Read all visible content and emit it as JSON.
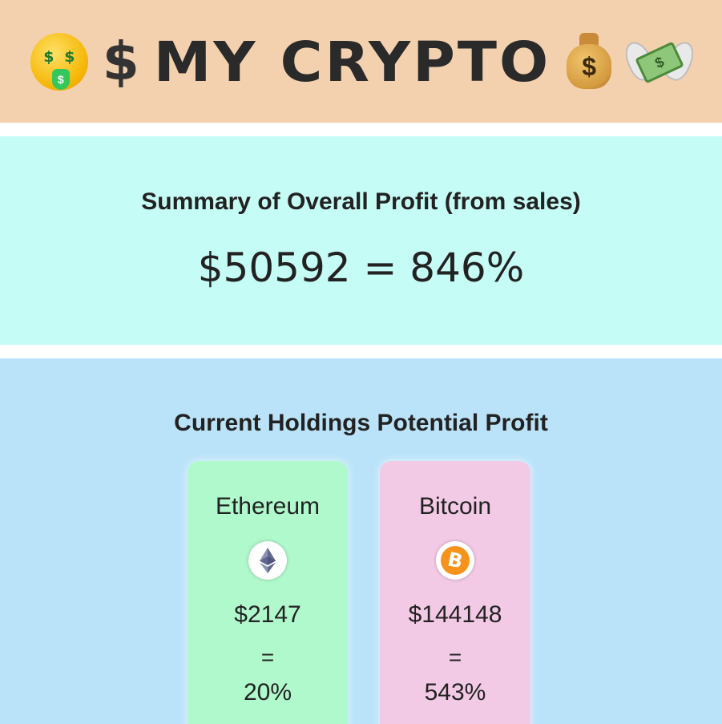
{
  "header": {
    "title": "MY CRYPTO",
    "dollar": "$",
    "background": "#f3d1ae",
    "icons": [
      "money-mouth-face-icon",
      "dollar-sign-icon",
      "money-bag-icon",
      "money-with-wings-icon"
    ]
  },
  "summary": {
    "heading": "Summary of Overall Profit (from sales)",
    "value": "$50592 = 846%",
    "background": "#c6fcf6"
  },
  "holdings": {
    "heading": "Current Holdings Potential Profit",
    "background": "#bae3f9",
    "cards": [
      {
        "name": "Ethereum",
        "icon": "ethereum-icon",
        "value": "$2147",
        "equals": "=",
        "percent": "20%",
        "color": "#b0f9cc"
      },
      {
        "name": "Bitcoin",
        "icon": "bitcoin-icon",
        "value": "$144148",
        "equals": "=",
        "percent": "543%",
        "color": "#f3cae6"
      }
    ]
  }
}
